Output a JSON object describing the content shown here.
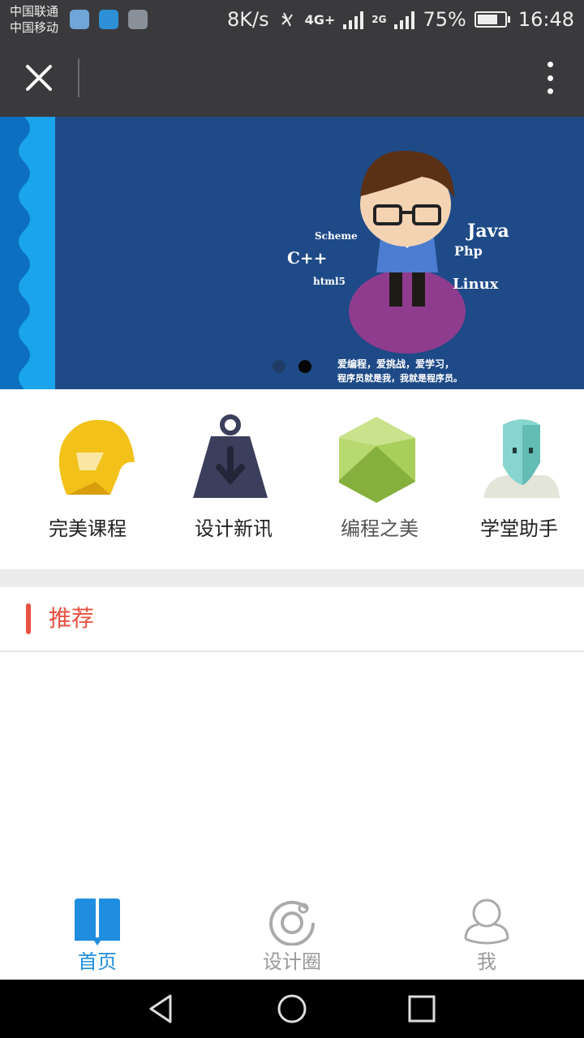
{
  "status_bar": {
    "carrier_1": "中国联通",
    "carrier_2": "中国移动",
    "net_speed": "8K/s",
    "network_1": "4G+",
    "network_2": "4G+",
    "network_3": "2G",
    "battery_percent": "75%",
    "battery_level": 0.75,
    "time": "16:48"
  },
  "nav_bar": {
    "close_icon": "close-icon",
    "more_icon": "more-vertical-icon"
  },
  "banner": {
    "languages": [
      "Java",
      "Scheme",
      "C++",
      "Php",
      "html5",
      "Linux"
    ],
    "slogan_line1": "爱编程，爱挑战，爱学习，",
    "slogan_line2": "程序员就是我，我就是程序员。",
    "slide_count": 2,
    "active_slide": 2
  },
  "quick_entries": [
    {
      "label": "完美课程",
      "icon": "helmet-icon",
      "color": "#f2c21a"
    },
    {
      "label": "设计新讯",
      "icon": "weight-download-icon",
      "color": "#3b3f5c"
    },
    {
      "label": "编程之美",
      "icon": "gem-icon",
      "color": "#a8cf5a"
    },
    {
      "label": "学堂助手",
      "icon": "robot-avatar-icon",
      "color": "#86d6cf"
    }
  ],
  "section": {
    "title": "推荐",
    "accent_color": "#e8503f"
  },
  "tab_bar": {
    "tabs": [
      {
        "label": "首页",
        "icon": "book-icon",
        "active": true
      },
      {
        "label": "设计圈",
        "icon": "circle-dot-icon",
        "active": false
      },
      {
        "label": "我",
        "icon": "user-icon",
        "active": false
      }
    ],
    "active_color": "#1f8ee0",
    "inactive_color": "#999999"
  },
  "system_nav": {
    "buttons": [
      "back-icon",
      "home-icon",
      "recents-icon"
    ]
  }
}
